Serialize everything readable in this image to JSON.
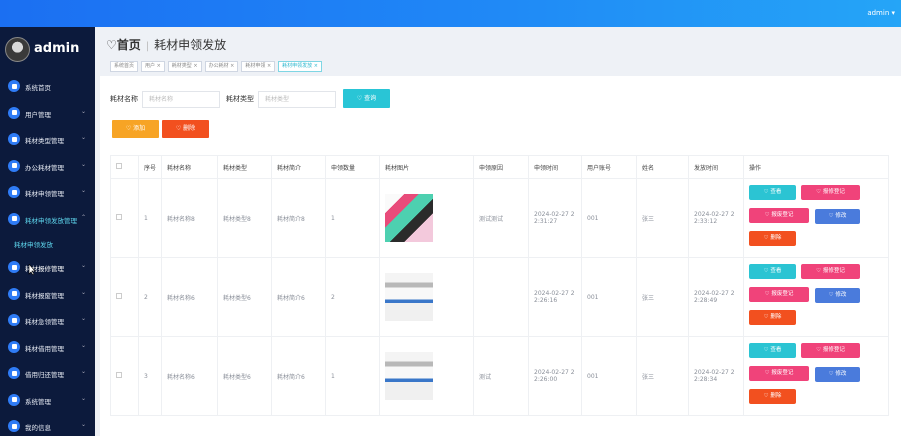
{
  "topbar": {
    "user": "admin ▾"
  },
  "sidebar": {
    "brand": "admin",
    "items": [
      {
        "label": "系统首页",
        "chev": ""
      },
      {
        "label": "用户管理",
        "chev": "⌄"
      },
      {
        "label": "耗材类型管理",
        "chev": "⌄"
      },
      {
        "label": "办公耗材管理",
        "chev": "⌄"
      },
      {
        "label": "耗材申领管理",
        "chev": "⌄"
      },
      {
        "label": "耗材申领发放管理",
        "chev": "⌃"
      },
      {
        "label": "耗材申领发放",
        "chev": ""
      },
      {
        "label": "耗材报修管理",
        "chev": "⌄"
      },
      {
        "label": "耗材报废管理",
        "chev": "⌄"
      },
      {
        "label": "耗材急领管理",
        "chev": "⌄"
      },
      {
        "label": "耗材借用管理",
        "chev": "⌄"
      },
      {
        "label": "借用归还管理",
        "chev": "⌄"
      },
      {
        "label": "系统管理",
        "chev": "⌄"
      },
      {
        "label": "我的信息",
        "chev": "⌄"
      }
    ]
  },
  "header": {
    "home": "♡首页",
    "title": "耗材申领发放"
  },
  "tags": [
    "系统首页",
    "用户 ×",
    "耗材类型 ×",
    "办公耗材 ×",
    "耗材申领 ×",
    "耗材申领发放 ×"
  ],
  "search": {
    "name_label": "耗材名称",
    "name_placeholder": "耗材名称",
    "type_label": "耗材类型",
    "type_placeholder": "耗材类型",
    "query": "♡ 查询"
  },
  "actions": {
    "add": "♡ 添加",
    "delete": "♡ 删除"
  },
  "table": {
    "headers": [
      "序号",
      "耗材名称",
      "耗材类型",
      "耗材简介",
      "申领数量",
      "耗材图片",
      "申领原因",
      "申领时间",
      "用户账号",
      "姓名",
      "发放时间",
      "操作"
    ],
    "rows": [
      {
        "no": "1",
        "name": "耗材名称8",
        "type": "耗材类型8",
        "intro": "耗材简介8",
        "qty": "1",
        "reason": "测试测试",
        "time": "2024-02-27 2\n2:31:27",
        "account": "001",
        "person": "张三",
        "issue": "2024-02-27 2\n2:33:12"
      },
      {
        "no": "2",
        "name": "耗材名称6",
        "type": "耗材类型6",
        "intro": "耗材简介6",
        "qty": "2",
        "reason": "",
        "time": "2024-02-27 2\n2:26:16",
        "account": "001",
        "person": "张三",
        "issue": "2024-02-27 2\n2:28:49"
      },
      {
        "no": "3",
        "name": "耗材名称6",
        "type": "耗材类型6",
        "intro": "耗材简介6",
        "qty": "1",
        "reason": "测试",
        "time": "2024-02-27 2\n2:26:00",
        "account": "001",
        "person": "张三",
        "issue": "2024-02-27 2\n2:28:34"
      }
    ],
    "ops": {
      "view": "♡ 查看",
      "report1": "♡ 报修登记",
      "report2": "♡ 报废登记",
      "edit": "♡ 修改",
      "del": "♡ 删除"
    }
  }
}
